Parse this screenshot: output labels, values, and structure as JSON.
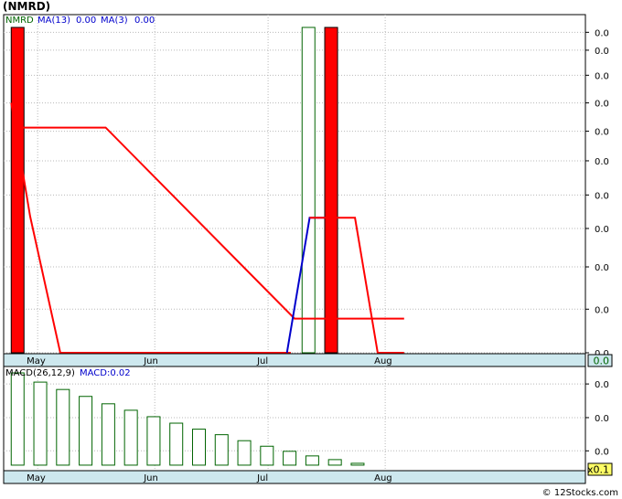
{
  "title": "(NMRD)",
  "colors": {
    "band": "#cde8ee",
    "grid": "#b9b9b9",
    "ma13": "#ff0000",
    "ma3": "#0000cc",
    "bar_down": "#ff0000",
    "bar_up": "#006400",
    "hist": "#006400",
    "symbol_green": "#006400",
    "highlight": "#ffff66"
  },
  "chart_data": [
    {
      "type": "bar",
      "panel": "price",
      "legend": [
        {
          "text": "NMRD",
          "color": "#006400"
        },
        {
          "text": "MA(13)",
          "color": "#0000cc"
        },
        {
          "text": "0.00",
          "color": "#0000cc"
        },
        {
          "text": "MA(3)",
          "color": "#0000cc"
        },
        {
          "text": "0.00",
          "color": "#0000cc"
        }
      ],
      "x_labels": [
        {
          "text": "May",
          "day": 3
        },
        {
          "text": "Jun",
          "day": 34
        },
        {
          "text": "Jul",
          "day": 64
        },
        {
          "text": "Aug",
          "day": 95
        }
      ],
      "x_range": [
        -6,
        148
      ],
      "y_range": [
        0,
        1
      ],
      "y_ticks": [
        {
          "text": "0.0",
          "v": 0.985
        },
        {
          "text": "0.0",
          "v": 0.93
        },
        {
          "text": "0.0",
          "v": 0.853
        },
        {
          "text": "0.0",
          "v": 0.768
        },
        {
          "text": "0.0",
          "v": 0.681
        },
        {
          "text": "0.0",
          "v": 0.59
        },
        {
          "text": "0.0",
          "v": 0.485
        },
        {
          "text": "0.0",
          "v": 0.382
        },
        {
          "text": "0.0",
          "v": 0.264
        },
        {
          "text": "0.0",
          "v": 0.134
        },
        {
          "text": "0.0",
          "v": 0.0
        }
      ],
      "last_value": "0.0",
      "bars": [
        {
          "day": -4,
          "high": 1.0,
          "low": 0.0,
          "dir": "down"
        },
        {
          "day": 73,
          "high": 1.0,
          "low": 0.0,
          "dir": "up"
        },
        {
          "day": 79,
          "high": 1.0,
          "low": 0.0,
          "dir": "down"
        }
      ],
      "series": [
        {
          "name": "MA(13)",
          "color": "#ff0000",
          "points": [
            [
              -3,
              0.692
            ],
            [
              21,
              0.692
            ],
            [
              71,
              0.105
            ],
            [
              93,
              0.105
            ],
            [
              93,
              0.105
            ],
            [
              93,
              0.105
            ],
            [
              93,
              0.105
            ],
            [
              100,
              0.105
            ]
          ]
        },
        {
          "name": "MA(3)",
          "color": "#ff0000",
          "points": [
            [
              -4,
              0.768
            ],
            [
              1,
              0.42
            ],
            [
              9,
              0.0
            ],
            [
              53,
              0.0
            ],
            [
              70,
              0.0
            ],
            [
              70,
              0.0
            ]
          ]
        },
        {
          "name": "MA(3)",
          "color": "#0000cc",
          "points": [
            [
              69,
              0.0
            ],
            [
              75,
              0.415
            ],
            [
              79,
              0.415
            ]
          ]
        },
        {
          "name": "MA(3)",
          "color": "#ff0000",
          "points": [
            [
              75,
              0.415
            ],
            [
              87,
              0.415
            ],
            [
              93,
              0.0
            ],
            [
              100,
              0.0
            ]
          ]
        }
      ]
    },
    {
      "type": "bar",
      "panel": "macd",
      "label": "MACD(26,12,9)",
      "value_label": "MACD:0.02",
      "y_range": [
        -0.05,
        1.0
      ],
      "y_ticks": [
        {
          "text": "0.0",
          "v": 0.88
        },
        {
          "text": "0.0",
          "v": 0.515
        },
        {
          "text": "0.0",
          "v": 0.155
        }
      ],
      "multiplier": "x0.1",
      "x_labels": [
        {
          "text": "May",
          "day": 3
        },
        {
          "text": "Jun",
          "day": 34
        },
        {
          "text": "Jul",
          "day": 64
        },
        {
          "text": "Aug",
          "day": 95
        }
      ],
      "bars": [
        {
          "day": -4,
          "value": 1.0
        },
        {
          "day": 2,
          "value": 0.9
        },
        {
          "day": 8,
          "value": 0.82
        },
        {
          "day": 14,
          "value": 0.745
        },
        {
          "day": 20,
          "value": 0.665
        },
        {
          "day": 26,
          "value": 0.595
        },
        {
          "day": 32,
          "value": 0.525
        },
        {
          "day": 38,
          "value": 0.455
        },
        {
          "day": 44,
          "value": 0.39
        },
        {
          "day": 50,
          "value": 0.33
        },
        {
          "day": 56,
          "value": 0.265
        },
        {
          "day": 62,
          "value": 0.205
        },
        {
          "day": 68,
          "value": 0.15
        },
        {
          "day": 74,
          "value": 0.1
        },
        {
          "day": 80,
          "value": 0.06
        },
        {
          "day": 86,
          "value": 0.02
        }
      ]
    }
  ],
  "footer": "© 12Stocks.com"
}
